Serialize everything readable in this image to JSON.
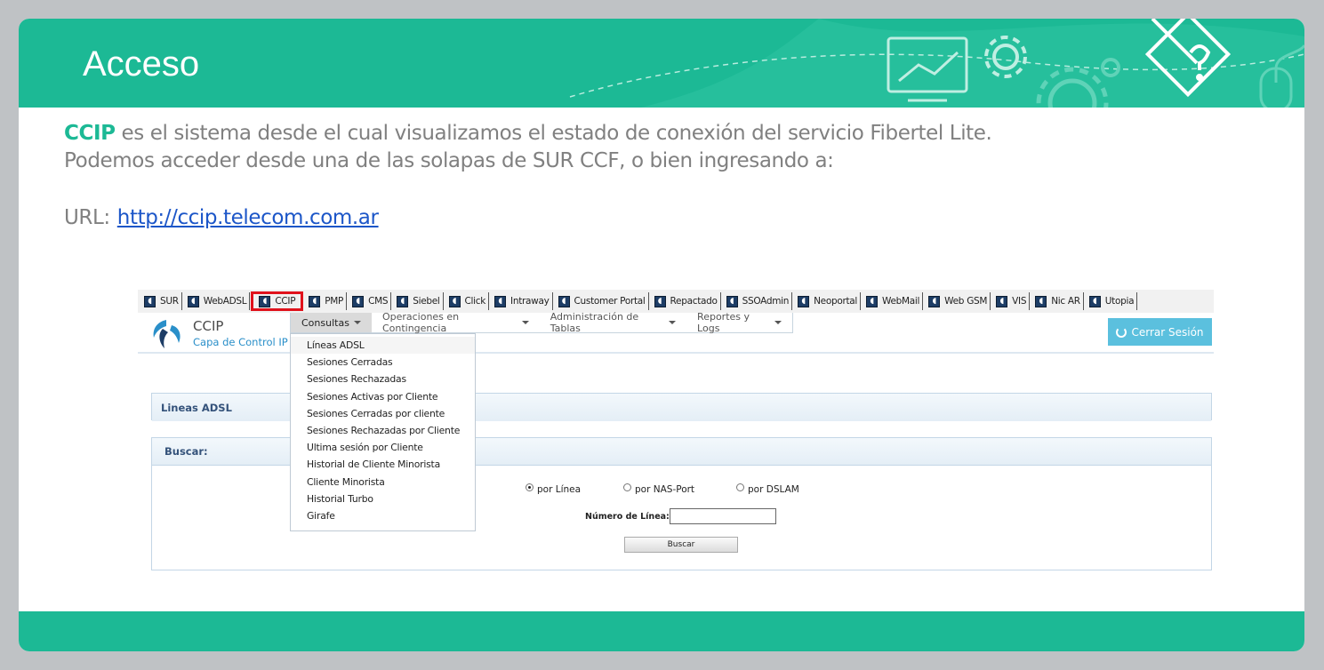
{
  "slide": {
    "title": "Acceso",
    "intro_highlight": "CCIP",
    "intro_line1_rest": " es el sistema desde el cual visualizamos el estado de conexión del servicio Fibertel Lite.",
    "intro_line2": "Podemos acceder desde una de las solapas de SUR CCF, o bien ingresando a:",
    "url_label": "URL:",
    "url_link": "http://ccip.telecom.com.ar",
    "colors": {
      "accent": "#1cb995",
      "link": "#1c56c8",
      "body_text": "#808080",
      "frame": "#bfc2c5"
    }
  },
  "app": {
    "tabs": [
      {
        "label": "SUR",
        "icon": "app-tab-icon"
      },
      {
        "label": "WebADSL",
        "icon": "app-tab-icon"
      },
      {
        "label": "CCIP",
        "icon": "app-tab-icon",
        "active": true
      },
      {
        "label": "PMP",
        "icon": "app-tab-icon"
      },
      {
        "label": "CMS",
        "icon": "app-tab-icon"
      },
      {
        "label": "Siebel",
        "icon": "app-tab-icon"
      },
      {
        "label": "Click",
        "icon": "app-tab-icon"
      },
      {
        "label": "Intraway",
        "icon": "app-tab-icon"
      },
      {
        "label": "Customer Portal",
        "icon": "app-tab-icon"
      },
      {
        "label": "Repactado",
        "icon": "app-tab-icon"
      },
      {
        "label": "SSOAdmin",
        "icon": "app-tab-icon"
      },
      {
        "label": "Neoportal",
        "icon": "app-tab-icon"
      },
      {
        "label": "WebMail",
        "icon": "app-tab-icon"
      },
      {
        "label": "Web GSM",
        "icon": "app-tab-icon"
      },
      {
        "label": "VIS",
        "icon": "app-tab-icon"
      },
      {
        "label": "Nic AR",
        "icon": "app-tab-icon"
      },
      {
        "label": "Utopia",
        "icon": "app-tab-icon"
      }
    ],
    "brand_name": "CCIP",
    "brand_sub": "Capa de Control IP",
    "menu": [
      {
        "label": "Consultas"
      },
      {
        "label": "Operaciones en Contingencia"
      },
      {
        "label": "Administración de Tablas"
      },
      {
        "label": "Reportes y Logs"
      }
    ],
    "logout_label": "Cerrar Sesión",
    "dropdown": [
      "Líneas ADSL",
      "Sesiones Cerradas",
      "Sesiones Rechazadas",
      "Sesiones Activas por Cliente",
      "Sesiones Cerradas por cliente",
      "Sesiones Rechazadas por Cliente",
      "Ultima sesión por Cliente",
      "Historial de Cliente Minorista",
      "Cliente Minorista",
      "Historial Turbo",
      "Girafe"
    ],
    "panel1_title": "Lineas ADSL",
    "panel2_title": "Buscar:",
    "radios": [
      {
        "label": "por Línea",
        "checked": true
      },
      {
        "label": "por NAS-Port",
        "checked": false
      },
      {
        "label": "por DSLAM",
        "checked": false
      }
    ],
    "number_label": "Número de Línea:",
    "number_value": "",
    "search_button": "Buscar"
  }
}
